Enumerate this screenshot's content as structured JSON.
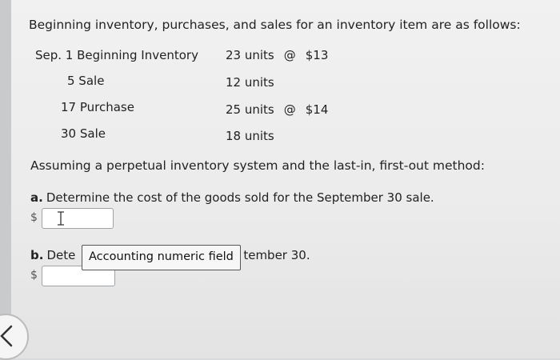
{
  "intro": "Beginning inventory, purchases, and sales for an inventory item are as follows:",
  "rows": [
    {
      "date": "Sep. 1 Beginning Inventory",
      "qty": "23 units",
      "at": "@",
      "cost": "$13"
    },
    {
      "date": "5 Sale",
      "qty": "12 units"
    },
    {
      "date": "17 Purchase",
      "qty": "25 units",
      "at": "@",
      "cost": "$14"
    },
    {
      "date": "30 Sale",
      "qty": "18 units"
    }
  ],
  "assumption": "Assuming a perpetual inventory system and the last-in, first-out method:",
  "question_a": {
    "letter": "a.",
    "text": "Determine the cost of the goods sold for the September 30 sale."
  },
  "question_b": {
    "letter": "b.",
    "text_start": "Dete",
    "text_end": "tember 30."
  },
  "currency_symbol": "$",
  "tooltip": "Accounting numeric field"
}
